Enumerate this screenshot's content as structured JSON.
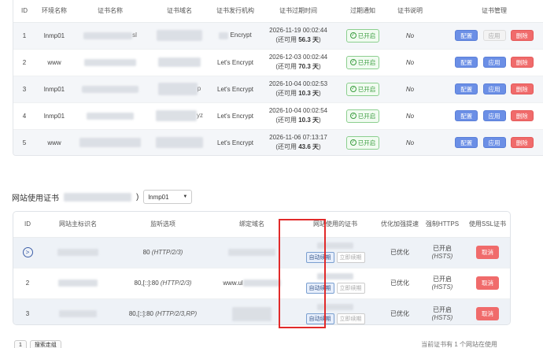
{
  "top_table": {
    "headers": [
      "ID",
      "环境名称",
      "证书名称",
      "证书域名",
      "证书发行机构",
      "证书过期时间",
      "过期通知",
      "证书说明",
      "证书管理"
    ],
    "rows": [
      {
        "id": "1",
        "env": "lnmp01",
        "issuer": "Encrypt",
        "expire": "2026-11-19 00:02:44",
        "remain": "(还可用 ",
        "days": "56.3 天",
        "close": ")",
        "notify": "已开启",
        "note": "No",
        "actions": [
          "配置",
          "应用",
          "删除"
        ],
        "apply_disabled": true
      },
      {
        "id": "2",
        "env": "www",
        "issuer": "Let's Encrypt",
        "expire": "2026-12-03 00:02:44",
        "remain": "(还可用 ",
        "days": "70.3 天",
        "close": ")",
        "notify": "已开启",
        "note": "No",
        "actions": [
          "配置",
          "应用",
          "删除"
        ],
        "apply_disabled": false
      },
      {
        "id": "3",
        "env": "lnmp01",
        "issuer": "Let's Encrypt",
        "expire": "2026-10-04 00:02:53",
        "remain": "(还可用 ",
        "days": "10.3 天",
        "close": ")",
        "notify": "已开启",
        "note": "No",
        "actions": [
          "配置",
          "应用",
          "删除"
        ],
        "apply_disabled": false
      },
      {
        "id": "4",
        "env": "lnmp01",
        "issuer": "Let's Encrypt",
        "expire": "2026-10-04 00:02:54",
        "remain": "(还可用 ",
        "days": "10.3 天",
        "close": ")",
        "notify": "已开启",
        "note": "No",
        "actions": [
          "配置",
          "应用",
          "删除"
        ],
        "apply_disabled": false
      },
      {
        "id": "5",
        "env": "www",
        "issuer": "Let's Encrypt",
        "expire": "2026-11-06 07:13:17",
        "remain": "(还可用 ",
        "days": "43.6 天",
        "close": ")",
        "notify": "已开启",
        "note": "No",
        "actions": [
          "配置",
          "应用",
          "删除"
        ],
        "apply_disabled": false
      }
    ]
  },
  "site_section": {
    "label": "网站使用证书",
    "paren_close": ")",
    "select_value": "lnmp01"
  },
  "bottom_table": {
    "headers": [
      "ID",
      "网站主标识名",
      "监听选项",
      "绑定域名",
      "网站使用的证书",
      "优化加强提速",
      "强制HTTPS",
      "使用SSL证书"
    ],
    "rows": [
      {
        "id": ">",
        "listen_port": "80 ",
        "listen_proto": "(HTTP/2/3)",
        "domain_visible": "",
        "renew_on": "自动续期",
        "renew_off": "立即续期",
        "optimized": "已优化",
        "https_line1": "已开启",
        "https_line2": "(HSTS)",
        "action": "取消"
      },
      {
        "id": "2",
        "listen_port": "80,[::]:80 ",
        "listen_proto": "(HTTP/2/3)",
        "domain_visible": "www.ul",
        "renew_on": "自动续期",
        "renew_off": "立即续期",
        "optimized": "已优化",
        "https_line1": "已开启",
        "https_line2": "(HSTS)",
        "action": "取消"
      },
      {
        "id": "3",
        "listen_port": "80,[::]:80 ",
        "listen_proto": "(HTTP/2/3,RP)",
        "domain_visible": "",
        "renew_on": "自动续期",
        "renew_off": "立即续期",
        "optimized": "已优化",
        "https_line1": "已开启",
        "https_line2": "(HSTS)",
        "action": "取消"
      }
    ]
  },
  "pager": {
    "page": "1",
    "next": "搜索走组"
  },
  "footer_note": "当前证书有 1 个网站在使用",
  "colors": {
    "accent_blue": "#6b8fe6",
    "danger_red": "#f06b6b",
    "success_green": "#3a9d3f",
    "highlight_red": "#e12a2a"
  }
}
